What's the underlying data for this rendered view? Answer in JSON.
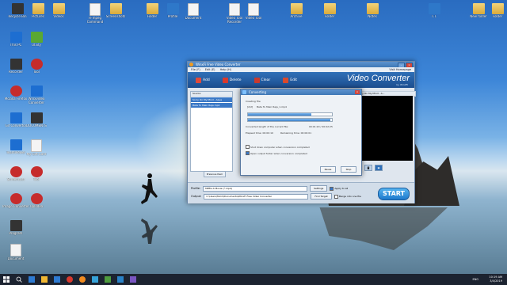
{
  "desktop": {
    "icons": [
      {
        "label": "Recycle Bin",
        "kind": "app-dark"
      },
      {
        "label": "Pictures",
        "kind": "folder"
      },
      {
        "label": "Videos",
        "kind": "folder"
      },
      {
        "label": "FFmpeg Command",
        "kind": "doc"
      },
      {
        "label": "Screenshots",
        "kind": "folder"
      },
      {
        "label": "Folder",
        "kind": "folder"
      },
      {
        "label": "Profile",
        "kind": "pic"
      },
      {
        "label": "Document",
        "kind": "doc"
      },
      {
        "label": "Video Tool Recorder",
        "kind": "doc"
      },
      {
        "label": "Video Tool",
        "kind": "doc"
      },
      {
        "label": "Archive",
        "kind": "folder"
      },
      {
        "label": "Folder",
        "kind": "folder"
      },
      {
        "label": "Notes",
        "kind": "folder"
      },
      {
        "label": "T.T.",
        "kind": "pic"
      },
      {
        "label": "New folder",
        "kind": "folder"
      },
      {
        "label": "Folder",
        "kind": "folder"
      },
      {
        "label": "This PC",
        "kind": "app-blue"
      },
      {
        "label": "Utility",
        "kind": "app-green"
      },
      {
        "label": "Recorder",
        "kind": "app-dark"
      },
      {
        "label": "Tool",
        "kind": "app-red"
      },
      {
        "label": "Mozilla Firefox",
        "kind": "app-red"
      },
      {
        "label": "Winxvideo Converter",
        "kind": "app-blue"
      },
      {
        "label": "Gif Convertor",
        "kind": "app-blue"
      },
      {
        "label": "DOCUMENTS",
        "kind": "app-dark"
      },
      {
        "label": "TeamViewer",
        "kind": "app-blue"
      },
      {
        "label": "My Gift Card",
        "kind": "doc"
      },
      {
        "label": "Screencast",
        "kind": "app-red"
      },
      {
        "label": "Tool",
        "kind": "app-red"
      },
      {
        "label": "Image Converter",
        "kind": "app-red"
      },
      {
        "label": "Uplodea",
        "kind": "app-red"
      },
      {
        "label": "Program",
        "kind": "app-dark"
      },
      {
        "label": "Document",
        "kind": "doc"
      }
    ]
  },
  "app": {
    "title": "WinxFi Free Video Converter",
    "menu": [
      "File (F)",
      "Edit (E)",
      "Help (H)"
    ],
    "homepage": "Visit Homepage",
    "toolbar": {
      "add": "Add",
      "delete": "Delete",
      "clear": "Clear",
      "edit": "Edit",
      "brand": "Video Converter",
      "brand_sub": "by WinXFi"
    },
    "source_header": "Source",
    "files": [
      "Sorry On My Mind - Aave",
      "Bate Tu Mein Raja.mp4"
    ],
    "preview_header": "Sorry On My Mind - A...",
    "prev_button": "Previous Item",
    "profile_label": "Profile:",
    "profile_value": "MPEG-4 Movie (*.mp4)",
    "output_label": "Output:",
    "output_value": "C:\\Users\\Tamil\\Documents\\WinxFi Free Video Converter",
    "settings_button": "Settings",
    "find_target_button": "Find Target",
    "apply_all": "Apply to all",
    "merge": "Merge into one file",
    "start": "START"
  },
  "dialog": {
    "title": "Converting",
    "creating": "Creating File",
    "file_index": "[2/2]",
    "file_name": "Bate Tu Mein Raja_1.mp4",
    "progress1": 0.75,
    "progress2": 0.98,
    "converted_label": "Converted length of the current file:",
    "converted_value": "00:01:20 / 00:02:25",
    "elapsed": "Elapsed time: 00:00:10",
    "remaining": "Remaining time: 00:00:01",
    "shutdown": "Shut down computer when conversion completed",
    "open_output": "Open output folder when conversion completed",
    "pause": "Pause",
    "stop": "Stop"
  },
  "taskbar": {
    "time": "10:19 AM",
    "date": "3/4/2019",
    "info": "ENG"
  }
}
